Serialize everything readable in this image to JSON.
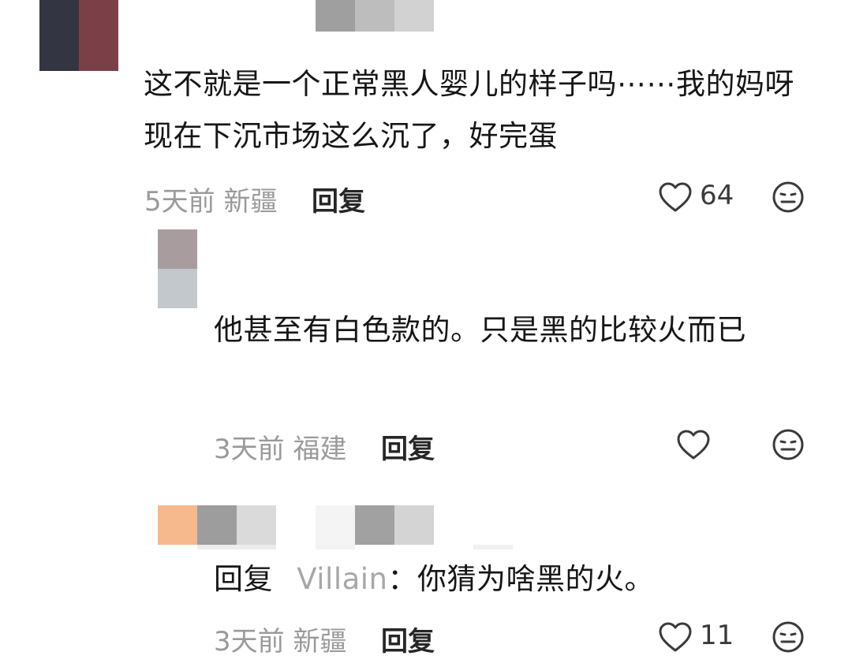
{
  "comments": [
    {
      "text": "这不就是一个正常黑人婴儿的样子吗⋯⋯我的妈呀现在下沉市场这么沉了，好完蛋",
      "meta": "5天前 新疆",
      "reply_label": "回复",
      "like_count": "64"
    },
    {
      "text": "他甚至有白色款的。只是黑的比较火而已",
      "meta": "3天前 福建",
      "reply_label": "回复",
      "like_count": ""
    },
    {
      "reply_prefix": "回复",
      "reply_to": "Villain",
      "text": "：你猜为啥黑的火。",
      "meta": "3天前 新疆",
      "reply_label": "回复",
      "like_count": "11"
    }
  ],
  "icons": [
    "heart-icon",
    "neutral-face-icon"
  ],
  "colors": {
    "text": "#161616",
    "meta": "#9a9a9a",
    "username": "#a7a7a7",
    "icon_stroke": "#3a3a3a"
  }
}
